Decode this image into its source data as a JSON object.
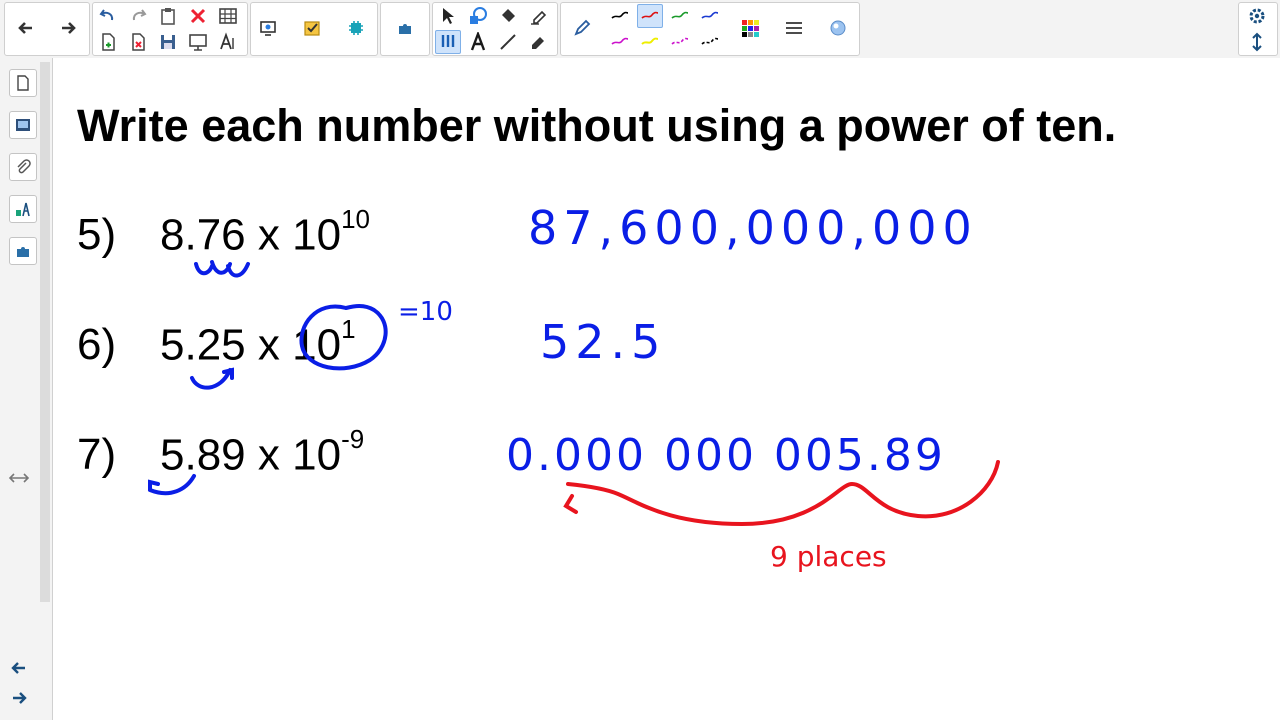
{
  "heading": "Write each number without using a power of ten.",
  "problems": [
    {
      "number": "5)",
      "mantissa": "8.76",
      "times": "x",
      "base": "10",
      "exponent": "10"
    },
    {
      "number": "6)",
      "mantissa": "5.25",
      "times": "x",
      "base": "10",
      "exponent": "1"
    },
    {
      "number": "7)",
      "mantissa": "5.89",
      "times": "x",
      "base": "10",
      "exponent": "-9"
    }
  ],
  "handwritten": {
    "answer5": "87,600,000,000",
    "answer6": "52.5",
    "answer7": "0.000 000 005.89",
    "note_eq": "=10",
    "note_places": "9 places"
  },
  "colors": {
    "ink_blue": "#0a1ee6",
    "ink_red": "#e8141e",
    "toolbar_bg": "#f3f3f3",
    "selected_bg": "#cfe3fb"
  },
  "toolbar": {
    "icons": [
      "back-arrow-icon",
      "forward-arrow-icon",
      "undo-icon",
      "redo-icon",
      "paste-icon",
      "delete-icon",
      "table-icon",
      "new-page-icon",
      "delete-page-icon",
      "save-icon",
      "screen-shade-icon",
      "text-recognition-icon",
      "document-camera-icon",
      "response-icon",
      "add-on-icon",
      "addon-puzzle-icon",
      "select-icon",
      "shapes-icon",
      "fill-icon",
      "eraser-fill-icon",
      "pen-icon",
      "pen-styles-icon",
      "text-icon",
      "line-icon",
      "eraser-icon",
      "creative-pen-icon",
      "color-palette-icon",
      "line-properties-icon",
      "magic-pen-icon",
      "settings-icon",
      "toolbar-position-icon"
    ]
  },
  "sidebar": {
    "icons": [
      "page-sorter-icon",
      "gallery-icon",
      "attachments-icon",
      "properties-icon",
      "add-ons-icon",
      "resize-sidebar-icon",
      "previous-page-icon",
      "next-page-icon"
    ]
  }
}
